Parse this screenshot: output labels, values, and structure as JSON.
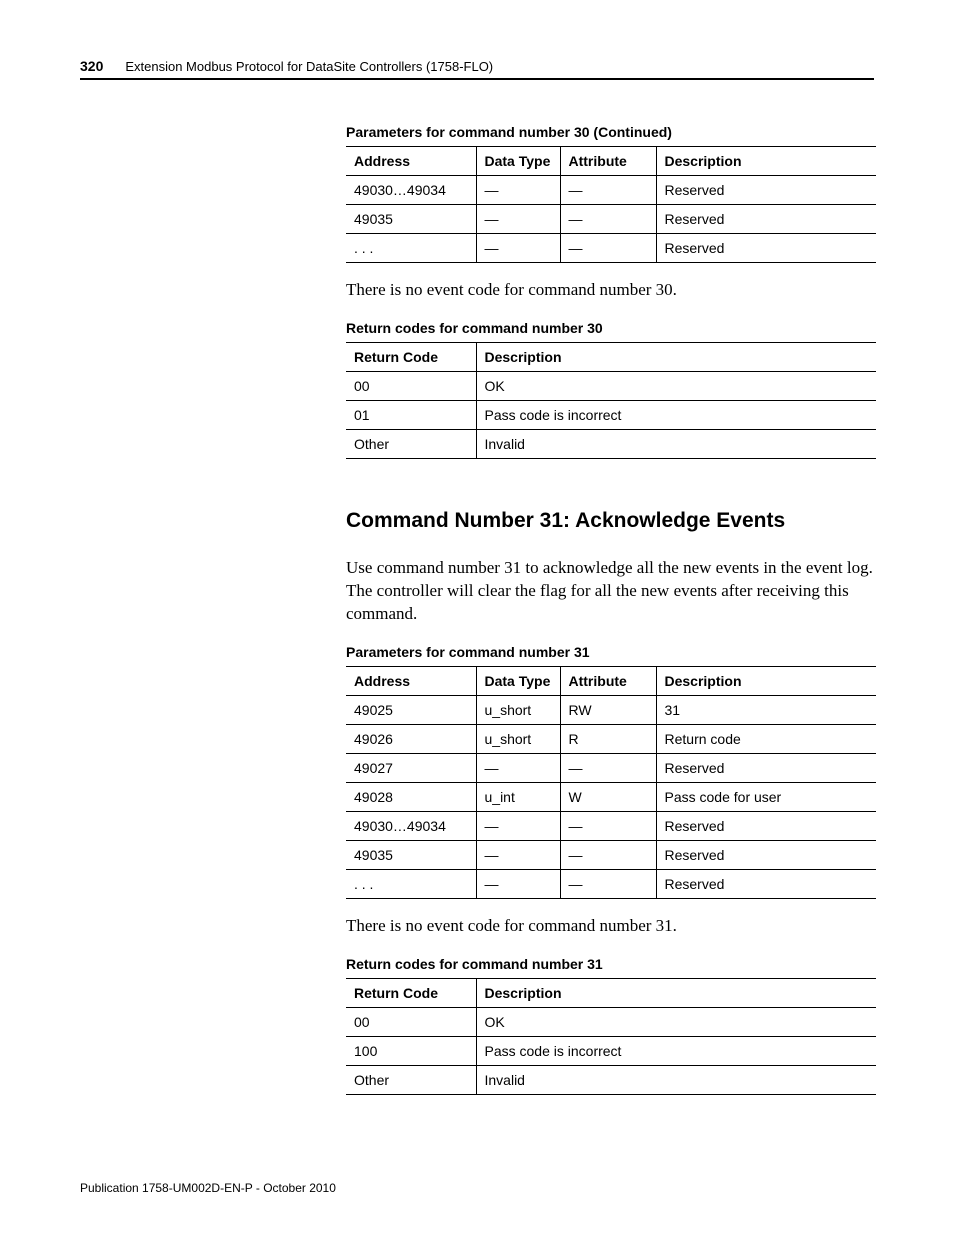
{
  "header": {
    "page_number": "320",
    "title": "Extension Modbus Protocol for DataSite Controllers (1758-FLO)"
  },
  "table1": {
    "caption": "Parameters for command number 30 (Continued)",
    "headers": {
      "c1": "Address",
      "c2": "Data Type",
      "c3": "Attribute",
      "c4": "Description"
    },
    "rows": [
      {
        "c1": "49030…49034",
        "c2": "—",
        "c3": "—",
        "c4": "Reserved"
      },
      {
        "c1": "49035",
        "c2": "—",
        "c3": "—",
        "c4": "Reserved"
      },
      {
        "c1": ". . .",
        "c2": "—",
        "c3": "—",
        "c4": "Reserved"
      }
    ]
  },
  "text1": "There is no event code for command number 30.",
  "table2": {
    "caption": "Return codes for command number 30",
    "headers": {
      "c1": "Return Code",
      "c2": "Description"
    },
    "rows": [
      {
        "c1": "00",
        "c2": "OK"
      },
      {
        "c1": "01",
        "c2": "Pass code is incorrect"
      },
      {
        "c1": "Other",
        "c2": "Invalid"
      }
    ]
  },
  "heading": "Command Number 31: Acknowledge Events",
  "text2": "Use command number 31 to acknowledge all the new events in the event log. The controller will clear the flag for all the new events after receiving this command.",
  "table3": {
    "caption": "Parameters for command number 31",
    "headers": {
      "c1": "Address",
      "c2": "Data Type",
      "c3": "Attribute",
      "c4": "Description"
    },
    "rows": [
      {
        "c1": "49025",
        "c2": "u_short",
        "c3": "RW",
        "c4": "31"
      },
      {
        "c1": "49026",
        "c2": "u_short",
        "c3": "R",
        "c4": "Return code"
      },
      {
        "c1": "49027",
        "c2": "—",
        "c3": "—",
        "c4": "Reserved"
      },
      {
        "c1": "49028",
        "c2": "u_int",
        "c3": "W",
        "c4": "Pass code for user"
      },
      {
        "c1": "49030…49034",
        "c2": "—",
        "c3": "—",
        "c4": "Reserved"
      },
      {
        "c1": "49035",
        "c2": "—",
        "c3": "—",
        "c4": "Reserved"
      },
      {
        "c1": ". . .",
        "c2": "—",
        "c3": "—",
        "c4": "Reserved"
      }
    ]
  },
  "text3": "There is no event code for command number 31.",
  "table4": {
    "caption": "Return codes for command number 31",
    "headers": {
      "c1": "Return Code",
      "c2": "Description"
    },
    "rows": [
      {
        "c1": "00",
        "c2": "OK"
      },
      {
        "c1": "100",
        "c2": "Pass code is incorrect"
      },
      {
        "c1": "Other",
        "c2": "Invalid"
      }
    ]
  },
  "footer": "Publication 1758-UM002D-EN-P - October 2010"
}
